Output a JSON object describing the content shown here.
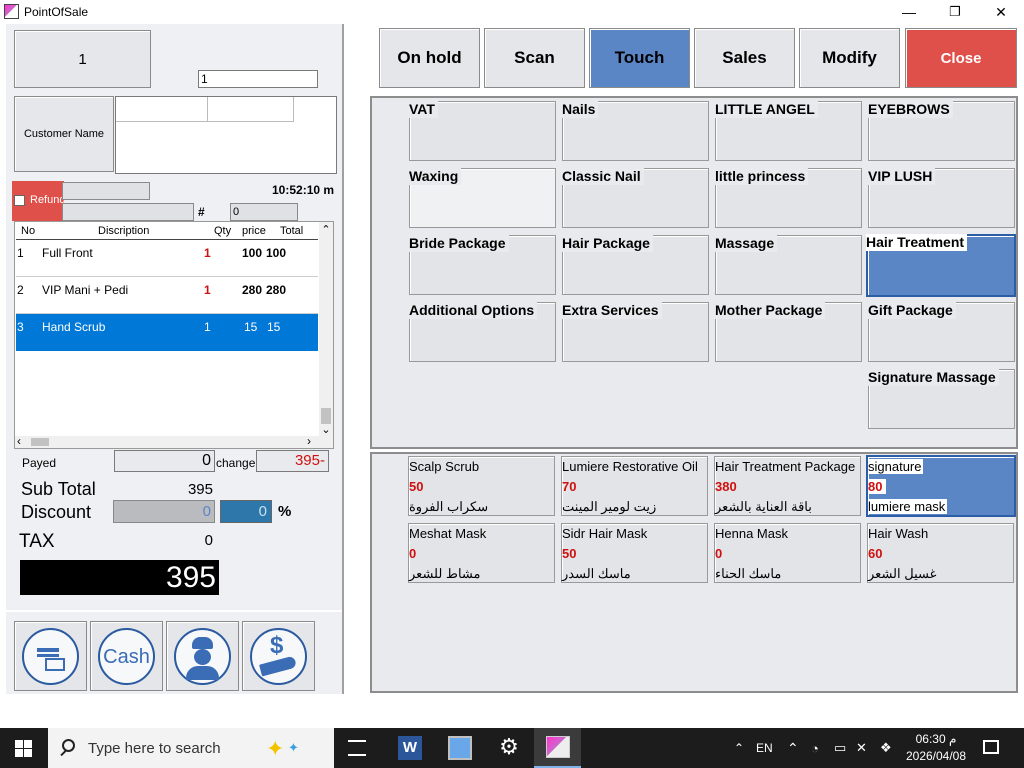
{
  "window": {
    "title": "PointOfSale",
    "minimize": "—",
    "maximize": "❐",
    "close": "✕"
  },
  "left": {
    "counter": "1",
    "qty_input": "1",
    "customer_label": "Customer Name",
    "refund_label": "Refund",
    "time": "10:52:10 m",
    "hash_label": "#",
    "hash_value": "0",
    "list": {
      "headers": {
        "no": "No",
        "description": "Discription",
        "qty": "Qty",
        "price": "price",
        "total": "Total"
      },
      "rows": [
        {
          "no": "1",
          "desc": "Full Front",
          "qty": "1",
          "price": "100",
          "total": "100"
        },
        {
          "no": "2",
          "desc": "VIP Mani + Pedi",
          "qty": "1",
          "price": "280",
          "total": "280"
        },
        {
          "no": "3",
          "desc": "Hand Scrub",
          "qty": "1",
          "price": "15",
          "total": "15"
        }
      ],
      "scroll_up": "⌃",
      "scroll_down": "⌄",
      "scroll_left": "‹",
      "scroll_right": "›"
    },
    "payed_label": "Payed",
    "payed_value": "0",
    "change_label": "change",
    "change_value": "395-",
    "subtotal_label": "Sub Total",
    "subtotal_value": "395",
    "discount_label": "Discount",
    "discount_value": "0",
    "discount_percent_value": "0",
    "percent_sign": "%",
    "tax_label": "TAX",
    "tax_value": "0",
    "grand_total": "395",
    "cash_label": "Cash"
  },
  "top_buttons": [
    {
      "label": "On hold"
    },
    {
      "label": "Scan"
    },
    {
      "label": "Touch",
      "color": "#5b86c6"
    },
    {
      "label": "Sales"
    },
    {
      "label": "Modify"
    },
    {
      "label": "Close",
      "color": "#e0504a"
    }
  ],
  "categories": [
    "VAT",
    "Nails",
    "LITTLE ANGEL",
    "EYEBROWS",
    "Waxing",
    "Classic Nail",
    "little princess",
    "VIP LUSH",
    "Bride Package",
    "Hair Package",
    "Massage",
    "Hair Treatment",
    "Additional Options",
    "Extra Services",
    "Mother Package",
    "Gift Package",
    "Signature Massage"
  ],
  "selected_category": "Hair Treatment",
  "products": [
    {
      "name": "Scalp Scrub",
      "price": "50",
      "arabic": "سكراب الفروة"
    },
    {
      "name": "Lumiere Restorative Oil",
      "price": "70",
      "arabic": "زيت لومير المينت"
    },
    {
      "name": "Hair Treatment Package",
      "price": "380",
      "arabic": "باقة العناية بالشعر"
    },
    {
      "name": "signature",
      "price": "80",
      "arabic": "lumiere mask"
    },
    {
      "name": "Meshat Mask",
      "price": "0",
      "arabic": "مشاط للشعر"
    },
    {
      "name": "Sidr Hair Mask",
      "price": "50",
      "arabic": "ماسك السدر"
    },
    {
      "name": "Henna Mask",
      "price": "0",
      "arabic": "ماسك الحناء"
    },
    {
      "name": "Hair Wash",
      "price": "60",
      "arabic": "غسيل الشعر"
    }
  ],
  "taskbar": {
    "search_placeholder": "Type here to search",
    "lang": "EN",
    "time": "06:30 م",
    "date": "2026/04/08"
  },
  "colors": {
    "accent": "#0078d7",
    "selected_tile": "#5b86c6",
    "close_button": "#e0504a",
    "price_red": "#d01010"
  }
}
